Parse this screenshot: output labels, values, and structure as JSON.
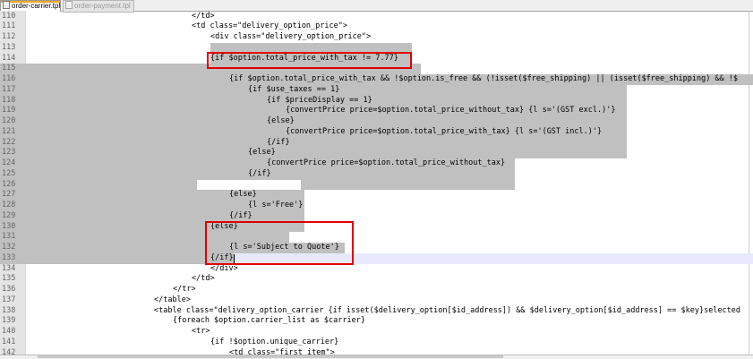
{
  "tabs": [
    {
      "label": "order-carrier.tpl",
      "active": true,
      "close_icon": "close-icon"
    },
    {
      "label": "order-payment.tpl",
      "active": false,
      "close_icon": "close-icon"
    }
  ],
  "colors": {
    "selection": "#c0c0c0",
    "highlight_box": "#e00000",
    "current_line": "#e8e8ff"
  },
  "lines": [
    {
      "num": "110",
      "code": "</td>"
    },
    {
      "num": "111",
      "code": "<td class=\"delivery_option_price\">"
    },
    {
      "num": "112",
      "code": "<div class=\"delivery_option_price\">"
    },
    {
      "num": "113",
      "code": ""
    },
    {
      "num": "114",
      "code": "{if $option.total_price_with_tax != 7.77}"
    },
    {
      "num": "115",
      "code": ""
    },
    {
      "num": "116",
      "code": "{if $option.total_price_with_tax && !$option.is_free && (!isset($free_shipping) || (isset($free_shipping) && !$"
    },
    {
      "num": "117",
      "code": "{if $use_taxes == 1}"
    },
    {
      "num": "118",
      "code": "{if $priceDisplay == 1}"
    },
    {
      "num": "119",
      "code": "{convertPrice price=$option.total_price_without_tax} {l s='(GST excl.)'}"
    },
    {
      "num": "120",
      "code": "{else}"
    },
    {
      "num": "121",
      "code": "{convertPrice price=$option.total_price_with_tax} {l s='(GST incl.)'}"
    },
    {
      "num": "122",
      "code": "{/if}"
    },
    {
      "num": "123",
      "code": "{else}"
    },
    {
      "num": "124",
      "code": "{convertPrice price=$option.total_price_without_tax}"
    },
    {
      "num": "125",
      "code": "{/if}"
    },
    {
      "num": "126",
      "code": ""
    },
    {
      "num": "127",
      "code": "{else}"
    },
    {
      "num": "128",
      "code": "{l s='Free'}"
    },
    {
      "num": "129",
      "code": "{/if}"
    },
    {
      "num": "130",
      "code": "{else}"
    },
    {
      "num": "131",
      "code": ""
    },
    {
      "num": "132",
      "code": "{l s='Subject to Quote'}"
    },
    {
      "num": "133",
      "code": "{/if}"
    },
    {
      "num": "134",
      "code": "</div>"
    },
    {
      "num": "135",
      "code": "</td>"
    },
    {
      "num": "136",
      "code": "</tr>"
    },
    {
      "num": "137",
      "code": "</table>"
    },
    {
      "num": "138",
      "code": "<table class=\"delivery_option_carrier {if isset($delivery_option[$id_address]) && $delivery_option[$id_address] == $key}selected"
    },
    {
      "num": "139",
      "code": "{foreach $option.carrier_list as $carrier}"
    },
    {
      "num": "140",
      "code": "<tr>"
    },
    {
      "num": "141",
      "code": "{if !$option.unique_carrier}"
    },
    {
      "num": "142",
      "code": "<td class=\"first_item\">"
    }
  ]
}
